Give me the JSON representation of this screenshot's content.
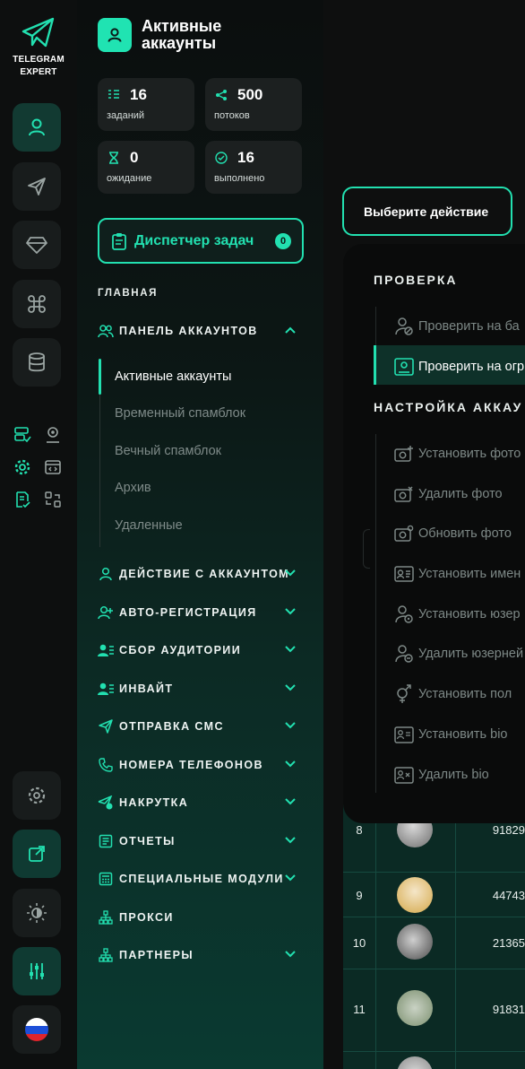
{
  "brand": {
    "name_line1": "TELEGRAM",
    "name_line2": "EXPERT",
    "accent": "#22e0b0"
  },
  "rail": {
    "buttons": [
      "user-icon",
      "send-icon",
      "diamond-icon",
      "command-icon",
      "database-icon"
    ],
    "small_icons": [
      "server-check-icon",
      "user-pin-icon",
      "gear-icon",
      "code-window-icon",
      "doc-check-icon",
      "swap-icon"
    ],
    "bottom": [
      "settings-icon",
      "external-link-icon",
      "brightness-icon",
      "sliders-icon",
      "flag-ru-icon"
    ]
  },
  "header": {
    "title": "Активные аккаунты"
  },
  "stats": [
    {
      "value": "16",
      "label": "заданий"
    },
    {
      "value": "500",
      "label": "потоков"
    },
    {
      "value": "0",
      "label": "ожидание"
    },
    {
      "value": "16",
      "label": "выполнено"
    }
  ],
  "dispatcher": {
    "label": "Диспетчер задач",
    "count": "0"
  },
  "nav": {
    "section": "ГЛАВНАЯ",
    "panel": "ПАНЕЛЬ АККАУНТОВ",
    "sub_items": [
      "Активные аккаунты",
      "Временный спамблок",
      "Вечный спамблок",
      "Архив",
      "Удаленные"
    ],
    "items": [
      "ДЕЙСТВИЕ С АККАУНТОМ",
      "АВТО-РЕГИСТРАЦИЯ",
      "СБОР АУДИТОРИИ",
      "ИНВАЙТ",
      "ОТПРАВКА СМС",
      "НОМЕРА ТЕЛЕФОНОВ",
      "НАКРУТКА",
      "ОТЧЕТЫ",
      "СПЕЦИАЛЬНЫЕ МОДУЛИ",
      "ПРОКСИ",
      "ПАРТНЕРЫ"
    ]
  },
  "main": {
    "action_button": "Выберите действие",
    "menu": {
      "section_check": "ПРОВЕРКА",
      "check_items": [
        "Проверить на ба",
        "Проверить на огр"
      ],
      "section_setup": "НАСТРОЙКА АККАУ",
      "setup_items": [
        "Установить фото",
        "Удалить фото",
        "Обновить фото",
        "Установить имен",
        "Установить юзер",
        "Удалить юзерней",
        "Установить пол",
        "Установить bio",
        "Удалить bio"
      ]
    },
    "rows": [
      {
        "num": "8",
        "id": "91829"
      },
      {
        "num": "9",
        "id": "44743"
      },
      {
        "num": "10",
        "id": "21365"
      },
      {
        "num": "11",
        "id": "91831"
      }
    ]
  }
}
